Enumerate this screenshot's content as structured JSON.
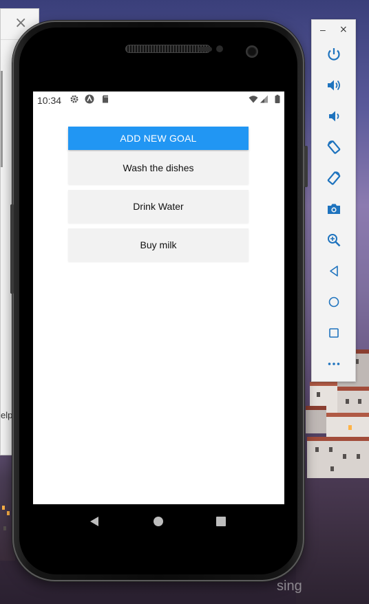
{
  "background_window": {
    "close_glyph": "×",
    "partial_text": "elp"
  },
  "device": {
    "status_bar": {
      "time": "10:34",
      "icons": [
        "gear-icon",
        "a-icon",
        "sd-card-icon",
        "wifi-icon",
        "signal-icon",
        "battery-icon"
      ]
    },
    "app": {
      "add_button_label": "ADD NEW GOAL",
      "goals": [
        "Wash the dishes",
        "Drink Water",
        "Buy milk"
      ]
    },
    "nav_bar": {
      "icons": [
        "back-icon",
        "home-icon",
        "recent-apps-icon"
      ]
    }
  },
  "emulator_toolbar": {
    "minimize_glyph": "–",
    "close_glyph": "×",
    "buttons": [
      "power-icon",
      "volume-up-icon",
      "volume-down-icon",
      "rotate-left-icon",
      "rotate-right-icon",
      "camera-icon",
      "zoom-icon",
      "back-icon",
      "home-icon",
      "overview-icon",
      "more-icon"
    ]
  },
  "wallpaper": {
    "watermark_text": "sing"
  },
  "colors": {
    "accent": "#2196f3",
    "goal_bg": "#f2f2f2",
    "toolbar_icon": "#1e73be"
  }
}
